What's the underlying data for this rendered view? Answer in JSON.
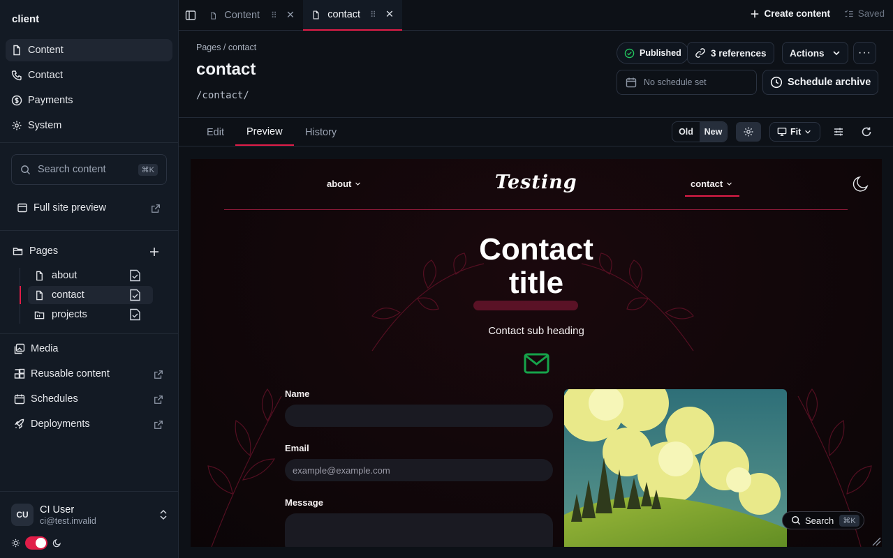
{
  "sidebar": {
    "brand": "client",
    "nav": [
      {
        "label": "Content",
        "icon": "document-icon",
        "active": true
      },
      {
        "label": "Contact",
        "icon": "phone-icon"
      },
      {
        "label": "Payments",
        "icon": "dollar-circle-icon"
      },
      {
        "label": "System",
        "icon": "gear-icon"
      }
    ],
    "search": {
      "placeholder": "Search content",
      "shortcut": "⌘K"
    },
    "full_site_preview": "Full site preview",
    "pages_label": "Pages",
    "pages": [
      {
        "label": "about"
      },
      {
        "label": "contact",
        "active": true
      },
      {
        "label": "projects"
      }
    ],
    "bottom_nav": [
      {
        "label": "Media",
        "external": false
      },
      {
        "label": "Reusable content",
        "external": true
      },
      {
        "label": "Schedules",
        "external": true
      },
      {
        "label": "Deployments",
        "external": true
      }
    ],
    "user": {
      "initials": "CU",
      "name": "CI User",
      "email": "ci@test.invalid"
    },
    "theme_toggle_on": true
  },
  "topbar": {
    "tabs": [
      {
        "label": "Content",
        "active": false
      },
      {
        "label": "contact",
        "active": true
      }
    ],
    "create_label": "Create content",
    "saved_label": "Saved"
  },
  "header": {
    "breadcrumb": "Pages / contact",
    "title": "contact",
    "path": "/contact/",
    "status": "Published",
    "references": "3 references",
    "actions": "Actions",
    "schedule_placeholder": "No schedule set",
    "schedule_archive": "Schedule archive"
  },
  "subtabs": {
    "items": [
      {
        "label": "Edit",
        "active": false
      },
      {
        "label": "Preview",
        "active": true
      },
      {
        "label": "History",
        "active": false
      }
    ],
    "compare_old": "Old",
    "compare_new": "New",
    "zoom": "Fit"
  },
  "preview": {
    "nav_left": "about",
    "logo": "Testing",
    "nav_right": "contact",
    "title_line1": "Contact",
    "title_line2": "title",
    "subheading": "Contact sub heading",
    "name_label": "Name",
    "email_label": "Email",
    "email_placeholder": "example@example.com",
    "message_label": "Message",
    "search_label": "Search",
    "search_shortcut": "⌘K"
  },
  "colors": {
    "accent": "#e11d48",
    "published_green": "#22c55e",
    "mail_green": "#16a34a"
  }
}
